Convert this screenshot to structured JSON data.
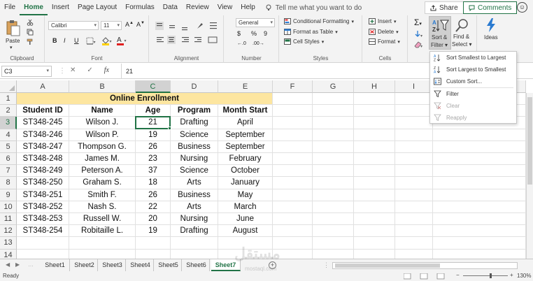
{
  "ribbon_tabs": [
    "File",
    "Home",
    "Insert",
    "Page Layout",
    "Formulas",
    "Data",
    "Review",
    "View",
    "Help"
  ],
  "active_tab": "Home",
  "tell_me": "Tell me what you want to do",
  "share_label": "Share",
  "comments_label": "Comments",
  "clipboard": {
    "paste_label": "Paste",
    "group_label": "Clipboard"
  },
  "font": {
    "name": "Calibri",
    "size": "11",
    "bold": "B",
    "italic": "I",
    "underline": "U",
    "group_label": "Font"
  },
  "alignment": {
    "group_label": "Alignment"
  },
  "number": {
    "format": "General",
    "currency": "$",
    "percent": "%",
    "comma": "9",
    "group_label": "Number"
  },
  "styles": {
    "conditional": "Conditional Formatting",
    "table": "Format as Table",
    "cell_styles": "Cell Styles",
    "group_label": "Styles"
  },
  "cells": {
    "insert": "Insert",
    "delete": "Delete",
    "format": "Format",
    "group_label": "Cells"
  },
  "editing": {
    "sort_filter_1": "Sort &",
    "sort_filter_2": "Filter",
    "find_select_1": "Find &",
    "find_select_2": "Select"
  },
  "ideas": {
    "label": "Ideas"
  },
  "sort_menu": {
    "items": [
      "Sort Smallest to Largest",
      "Sort Largest to Smallest",
      "Custom Sort...",
      "Filter",
      "Clear",
      "Reapply"
    ]
  },
  "formula_bar": {
    "name_box": "C3",
    "fx": "fx",
    "value": "21"
  },
  "columns": [
    "A",
    "B",
    "C",
    "D",
    "E",
    "F",
    "G",
    "H",
    "I"
  ],
  "rows": [
    "1",
    "2",
    "3",
    "4",
    "5",
    "6",
    "7",
    "8",
    "9",
    "10",
    "11",
    "12",
    "13",
    "14"
  ],
  "sheet": {
    "title": "Online Enrollment",
    "headers": [
      "Student ID",
      "Name",
      "Age",
      "Program",
      "Month Start"
    ],
    "data": [
      [
        "ST348-245",
        "Wilson J.",
        "21",
        "Drafting",
        "April"
      ],
      [
        "ST348-246",
        "Wilson P.",
        "19",
        "Science",
        "September"
      ],
      [
        "ST348-247",
        "Thompson G.",
        "26",
        "Business",
        "September"
      ],
      [
        "ST348-248",
        "James M.",
        "23",
        "Nursing",
        "February"
      ],
      [
        "ST348-249",
        "Peterson A.",
        "37",
        "Science",
        "October"
      ],
      [
        "ST348-250",
        "Graham S.",
        "18",
        "Arts",
        "January"
      ],
      [
        "ST348-251",
        "Smith F.",
        "26",
        "Business",
        "May"
      ],
      [
        "ST348-252",
        "Nash S.",
        "22",
        "Arts",
        "March"
      ],
      [
        "ST348-253",
        "Russell W.",
        "20",
        "Nursing",
        "June"
      ],
      [
        "ST348-254",
        "Robitaille L.",
        "19",
        "Drafting",
        "August"
      ]
    ]
  },
  "sheet_tabs": [
    "Sheet1",
    "Sheet2",
    "Sheet3",
    "Sheet4",
    "Sheet5",
    "Sheet6",
    "Sheet7"
  ],
  "active_sheet": "Sheet7",
  "status": {
    "ready": "Ready",
    "zoom": "130%"
  },
  "watermark": "مستقل",
  "watermark_url": "mostaql.com",
  "colors": {
    "accent": "#217346",
    "title_fill": "#fde6a0"
  }
}
